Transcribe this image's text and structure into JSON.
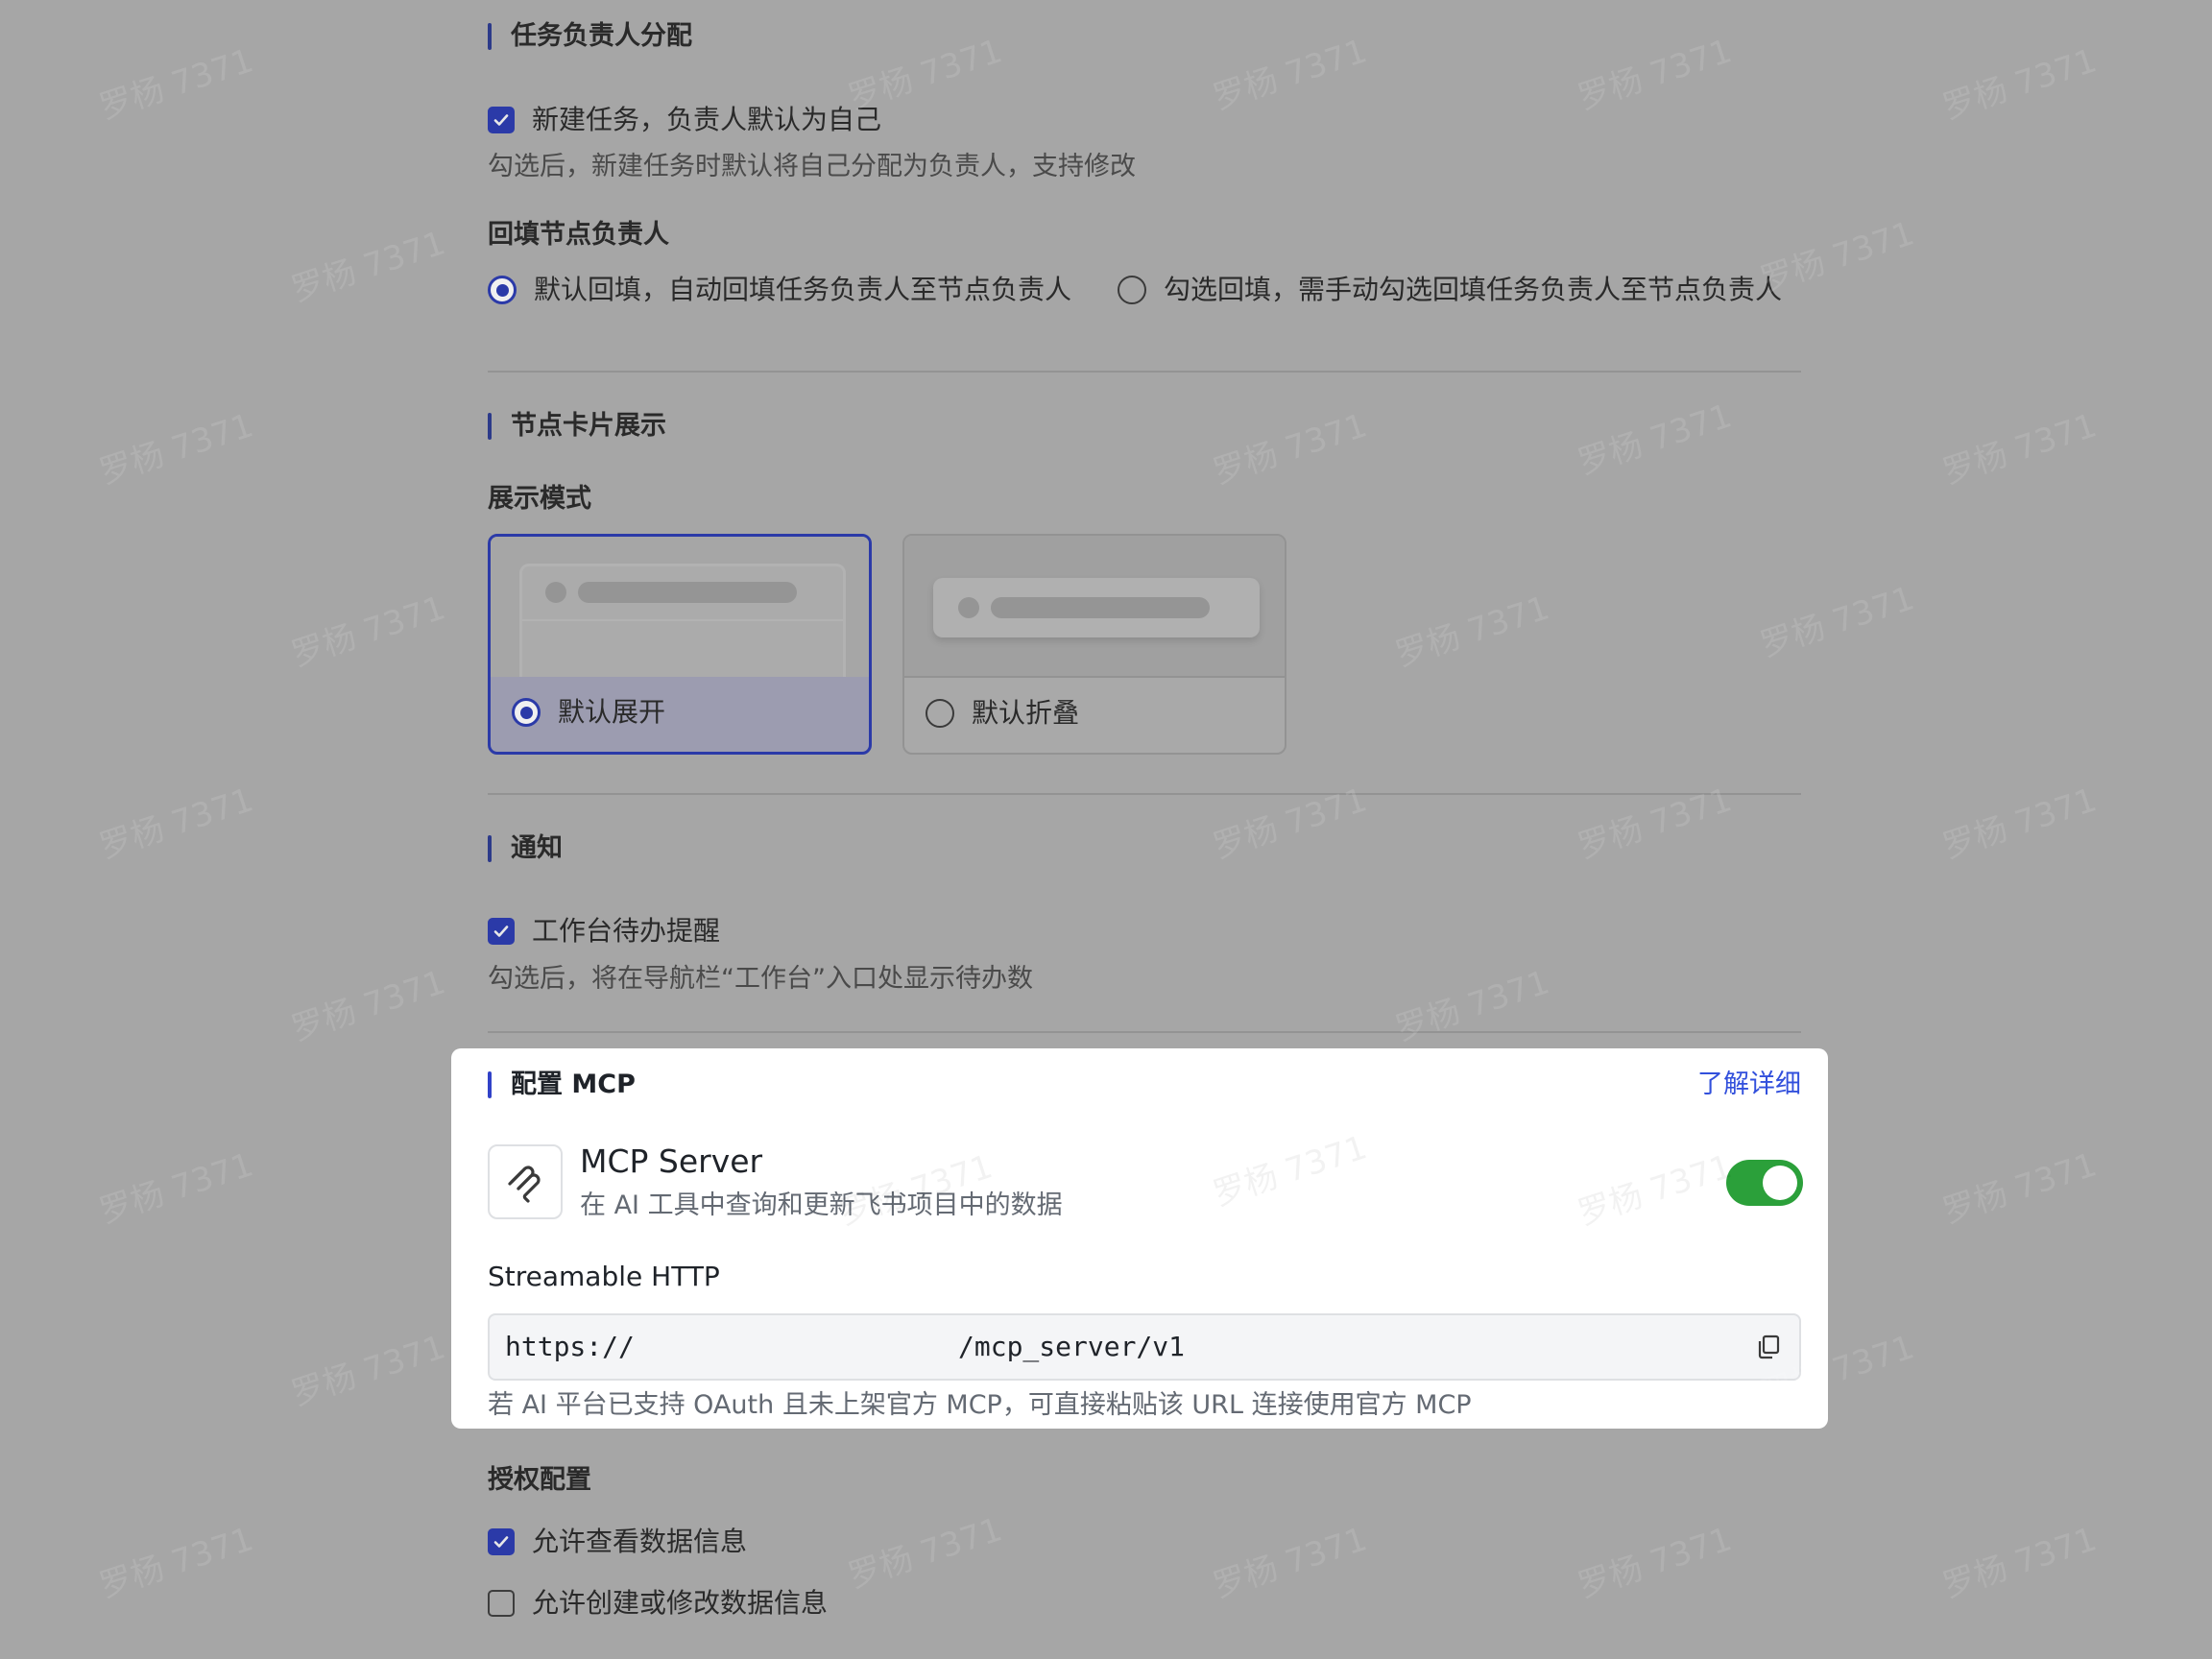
{
  "sections": {
    "assignee": {
      "title": "任务负责人分配",
      "default_self_label": "新建任务，负责人默认为自己",
      "default_self_checked": true,
      "default_self_desc": "勾选后，新建任务时默认将自己分配为负责人，支持修改",
      "backfill_title": "回填节点负责人",
      "backfill_options": [
        {
          "label": "默认回填，自动回填任务负责人至节点负责人",
          "selected": true
        },
        {
          "label": "勾选回填，需手动勾选回填任务负责人至节点负责人",
          "selected": false
        }
      ]
    },
    "node_card": {
      "title": "节点卡片展示",
      "mode_title": "展示模式",
      "modes": [
        {
          "label": "默认展开",
          "selected": true
        },
        {
          "label": "默认折叠",
          "selected": false
        }
      ]
    },
    "notify": {
      "title": "通知",
      "workbench_label": "工作台待办提醒",
      "workbench_checked": true,
      "workbench_desc": "勾选后，将在导航栏“工作台”入口处显示待办数"
    },
    "mcp": {
      "title": "配置 MCP",
      "learn_more": "了解详细",
      "server_name": "MCP Server",
      "server_desc": "在 AI 工具中查询和更新飞书项目中的数据",
      "enabled": true,
      "protocol_label": "Streamable HTTP",
      "url_prefix": "https://",
      "url_suffix": "/mcp_server/v1",
      "hint": "若 AI 平台已支持 OAuth 且未上架官方 MCP，可直接粘贴该 URL 连接使用官方 MCP"
    },
    "auth": {
      "title": "授权配置",
      "options": [
        {
          "label": "允许查看数据信息",
          "checked": true
        },
        {
          "label": "允许创建或修改数据信息",
          "checked": false
        }
      ]
    }
  },
  "icons": {
    "check": "check-icon",
    "mcp": "mcp-logo-icon",
    "copy": "copy-icon"
  },
  "colors": {
    "accent": "#3142c8",
    "toggle_on": "#2ba03a",
    "link": "#3250dc"
  },
  "watermark": "罗杨 7371"
}
